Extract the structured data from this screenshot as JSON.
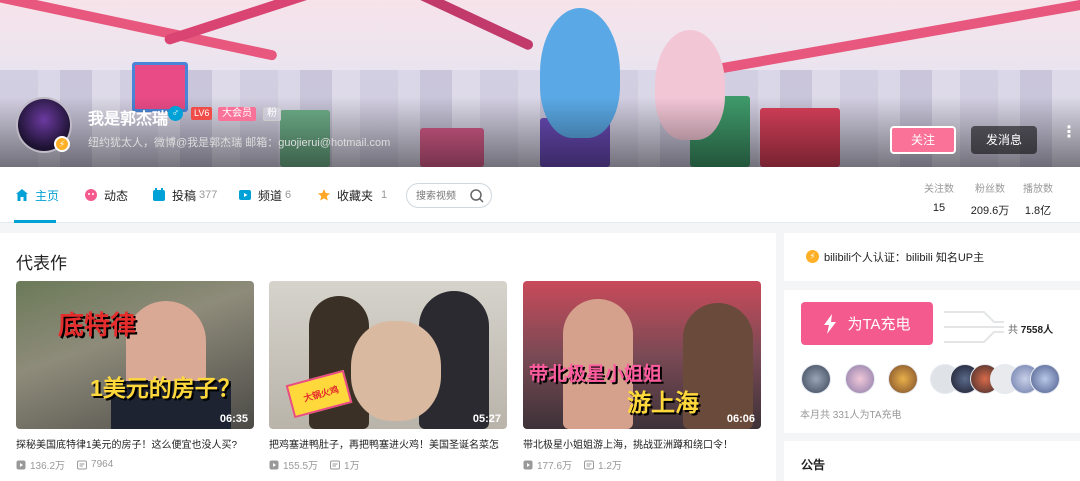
{
  "header": {
    "username": "我是郭杰瑞",
    "gender_symbol": "♂",
    "level_badge": "LV6",
    "vip_badge": "大会员",
    "fan_badge": "粉",
    "sign": "纽约犹太人，微博@我是郭杰瑞 邮箱：guojierui@hotmail.com",
    "follow_label": "关注",
    "message_label": "发消息",
    "more_symbol": "⋮"
  },
  "nav": {
    "items": [
      {
        "label": "主页",
        "count": "",
        "icon": "home-icon"
      },
      {
        "label": "动态",
        "count": "",
        "icon": "dynamic-icon"
      },
      {
        "label": "投稿",
        "count": "377",
        "icon": "upload-icon"
      },
      {
        "label": "频道",
        "count": "6",
        "icon": "channel-icon"
      },
      {
        "label": "收藏夹",
        "count": "1",
        "icon": "star-icon"
      }
    ],
    "search_placeholder": "搜索视频"
  },
  "stats": [
    {
      "label": "关注数",
      "value": "15"
    },
    {
      "label": "粉丝数",
      "value": "209.6万"
    },
    {
      "label": "播放数",
      "value": "1.8亿"
    }
  ],
  "masterpiece": {
    "title": "代表作",
    "videos": [
      {
        "caption1": "底特律",
        "caption2": "1美元的房子？",
        "duration": "06:35",
        "title": "探秘美国底特律1美元的房子！这么便宜也没人买?",
        "plays": "136.2万",
        "danmaku": "7964"
      },
      {
        "caption1": "大锅火鸡",
        "caption2": "",
        "duration": "05:27",
        "title": "把鸡塞进鸭肚子，再把鸭塞进火鸡！美国圣诞名菜怎",
        "plays": "155.5万",
        "danmaku": "1万"
      },
      {
        "caption1": "带北极星小姐姐",
        "caption2": "游上海",
        "duration": "06:06",
        "title": "带北极星小姐姐游上海，挑战亚洲蹲和绕口令！",
        "plays": "177.6万",
        "danmaku": "1.2万"
      }
    ]
  },
  "sidebar": {
    "cert_text": "bilibili个人认证：bilibili 知名UP主",
    "cert_icon": "⚡",
    "charge_label": "为TA充电",
    "charge_total_prefix": "共",
    "charge_total_value": "7558人",
    "charge_month": "本月共 331人为TA充电",
    "notice_title": "公告"
  },
  "colors": {
    "accent": "#00a1d6",
    "pink": "#fb7299",
    "charge": "#f45a8d"
  }
}
